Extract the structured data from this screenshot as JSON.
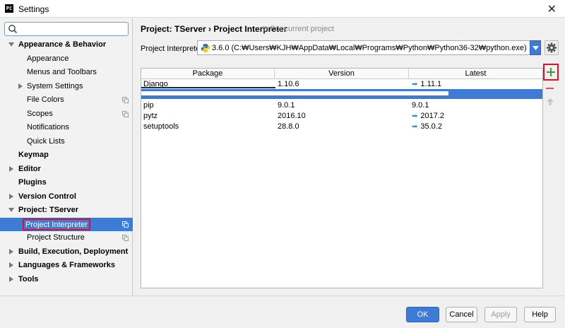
{
  "window": {
    "title": "Settings",
    "app_icon_text": "PC"
  },
  "search": {
    "placeholder": ""
  },
  "tree": [
    {
      "label": "Appearance & Behavior",
      "bold": true,
      "expanded": true,
      "level": 0
    },
    {
      "label": "Appearance",
      "bold": false,
      "level": 1
    },
    {
      "label": "Menus and Toolbars",
      "bold": false,
      "level": 1
    },
    {
      "label": "System Settings",
      "bold": false,
      "level": 1,
      "collapsed": true
    },
    {
      "label": "File Colors",
      "bold": false,
      "level": 1,
      "copy": true
    },
    {
      "label": "Scopes",
      "bold": false,
      "level": 1,
      "copy": true
    },
    {
      "label": "Notifications",
      "bold": false,
      "level": 1
    },
    {
      "label": "Quick Lists",
      "bold": false,
      "level": 1
    },
    {
      "label": "Keymap",
      "bold": true,
      "level": 0
    },
    {
      "label": "Editor",
      "bold": true,
      "level": 0,
      "collapsed": true
    },
    {
      "label": "Plugins",
      "bold": true,
      "level": 0
    },
    {
      "label": "Version Control",
      "bold": true,
      "level": 0,
      "collapsed": true
    },
    {
      "label": "Project: TServer",
      "bold": true,
      "level": 0,
      "expanded": true
    },
    {
      "label": "Project Interpreter",
      "bold": false,
      "level": 1,
      "copy": true,
      "selected": true
    },
    {
      "label": "Project Structure",
      "bold": false,
      "level": 1,
      "copy": true
    },
    {
      "label": "Build, Execution, Deployment",
      "bold": true,
      "level": 0,
      "collapsed": true
    },
    {
      "label": "Languages & Frameworks",
      "bold": true,
      "level": 0,
      "collapsed": true
    },
    {
      "label": "Tools",
      "bold": true,
      "level": 0,
      "collapsed": true
    }
  ],
  "breadcrumb": {
    "text": "Project: TServer › Project Interpreter",
    "note": "For current project"
  },
  "interpreter": {
    "label": "Project Interpreter:",
    "value": "3.6.0 (C:₩Users₩KJH₩AppData₩Local₩Programs₩Python₩Python36-32₩python.exe)"
  },
  "table": {
    "headers": [
      "Package",
      "Version",
      "Latest"
    ],
    "rows": [
      {
        "package": "Django",
        "version": "1.10.6",
        "latest": "1.11.1",
        "upgrade": true
      },
      {
        "package": "pip",
        "version": "9.0.1",
        "latest": "9.0.1",
        "upgrade": false
      },
      {
        "package": "pytz",
        "version": "2016.10",
        "latest": "2017.2",
        "upgrade": true
      },
      {
        "package": "setuptools",
        "version": "28.8.0",
        "latest": "35.0.2",
        "upgrade": true
      }
    ]
  },
  "buttons": {
    "ok": "OK",
    "cancel": "Cancel",
    "apply": "Apply",
    "help": "Help"
  },
  "colors": {
    "accent": "#3d7bd5",
    "highlight": "#e0102a",
    "add": "#3aa13a",
    "remove": "#d9534f"
  }
}
